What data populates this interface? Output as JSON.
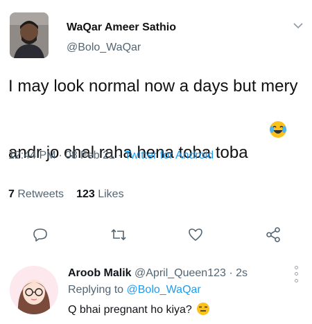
{
  "tweet": {
    "author": {
      "name": "WaQar Ameer Sathio",
      "handle": "@Bolo_WaQar"
    },
    "text": "I may look normal now a days but mery andr jo chal raha hena toba toba",
    "emoji": "face-with-tears-of-joy",
    "time": "12:44 PM",
    "separator": "·",
    "date": "08 Feb 21",
    "source": "Twitter for Android",
    "stats": {
      "retweets_count": "7",
      "retweets_label": "Retweets",
      "likes_count": "123",
      "likes_label": "Likes"
    },
    "actions": [
      "reply-icon",
      "retweet-icon",
      "like-icon",
      "share-icon"
    ]
  },
  "reply": {
    "name": "Aroob Malik",
    "handle": "@April_Queen123",
    "separator": "·",
    "time": "2s",
    "replying_label": "Replying to",
    "replying_to": "@Bolo_WaQar",
    "text": "Q bhai pregnant ho kiya?",
    "emoji": "expressionless-face"
  },
  "colors": {
    "link": "#1d9bf0",
    "secondary": "#536471",
    "primary_text": "#0f1419"
  }
}
